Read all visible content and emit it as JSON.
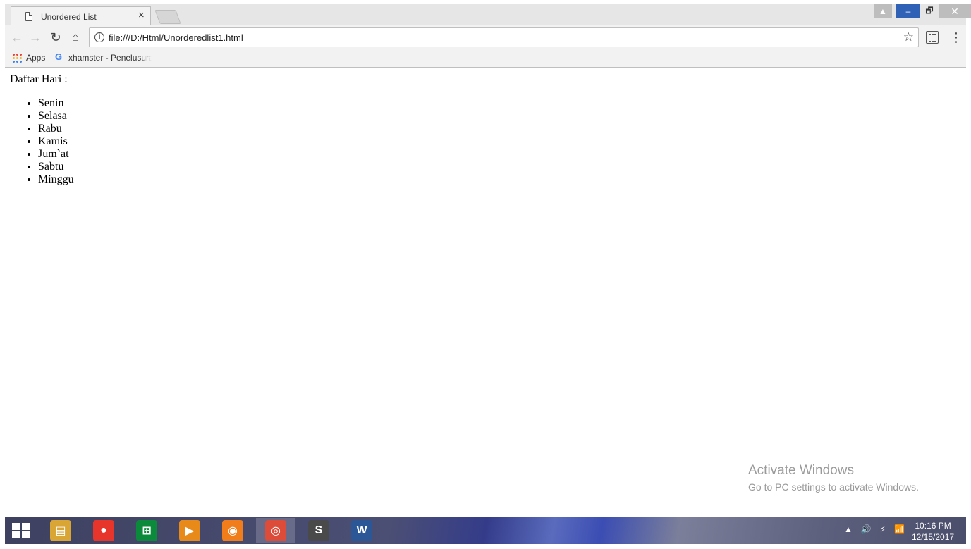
{
  "window": {
    "tab_title": "Unordered List",
    "tab_close": "×",
    "restore_label": "🗗",
    "minimize_label": "–",
    "close_label": "✕"
  },
  "toolbar": {
    "back": "←",
    "forward": "→",
    "reload": "↻",
    "home": "⌂",
    "url": "file:///D:/Html/Unorderedlist1.html",
    "star": "☆",
    "menu": "⋮"
  },
  "bookmarks": {
    "apps_label": "Apps",
    "items": [
      {
        "icon": "google-icon",
        "label": "xhamster - Penelusuran"
      }
    ]
  },
  "page": {
    "heading": "Daftar Hari :",
    "days": [
      "Senin",
      "Selasa",
      "Rabu",
      "Kamis",
      "Jum`at",
      "Sabtu",
      "Minggu"
    ]
  },
  "watermark": {
    "title": "Activate Windows",
    "subtitle": "Go to PC settings to activate Windows."
  },
  "taskbar": {
    "apps": [
      {
        "name": "file-explorer-icon",
        "color": "#d9a534",
        "glyph": "▤"
      },
      {
        "name": "paw-app-icon",
        "color": "#e8352b",
        "glyph": "●"
      },
      {
        "name": "store-icon",
        "color": "#0a8a3a",
        "glyph": "⊞"
      },
      {
        "name": "video-player-icon",
        "color": "#e88a1a",
        "glyph": "▶"
      },
      {
        "name": "uc-browser-icon",
        "color": "#f07d1a",
        "glyph": "◉"
      },
      {
        "name": "chrome-icon",
        "color": "#dd4b39",
        "glyph": "◎"
      },
      {
        "name": "sublime-text-icon",
        "color": "#4a4a4a",
        "glyph": "S"
      },
      {
        "name": "word-icon",
        "color": "#2b5797",
        "glyph": "W"
      }
    ],
    "tray_icons": [
      "▲",
      "🔊",
      "⚡",
      "📶"
    ],
    "time": "10:16 PM",
    "date": "12/15/2017"
  }
}
